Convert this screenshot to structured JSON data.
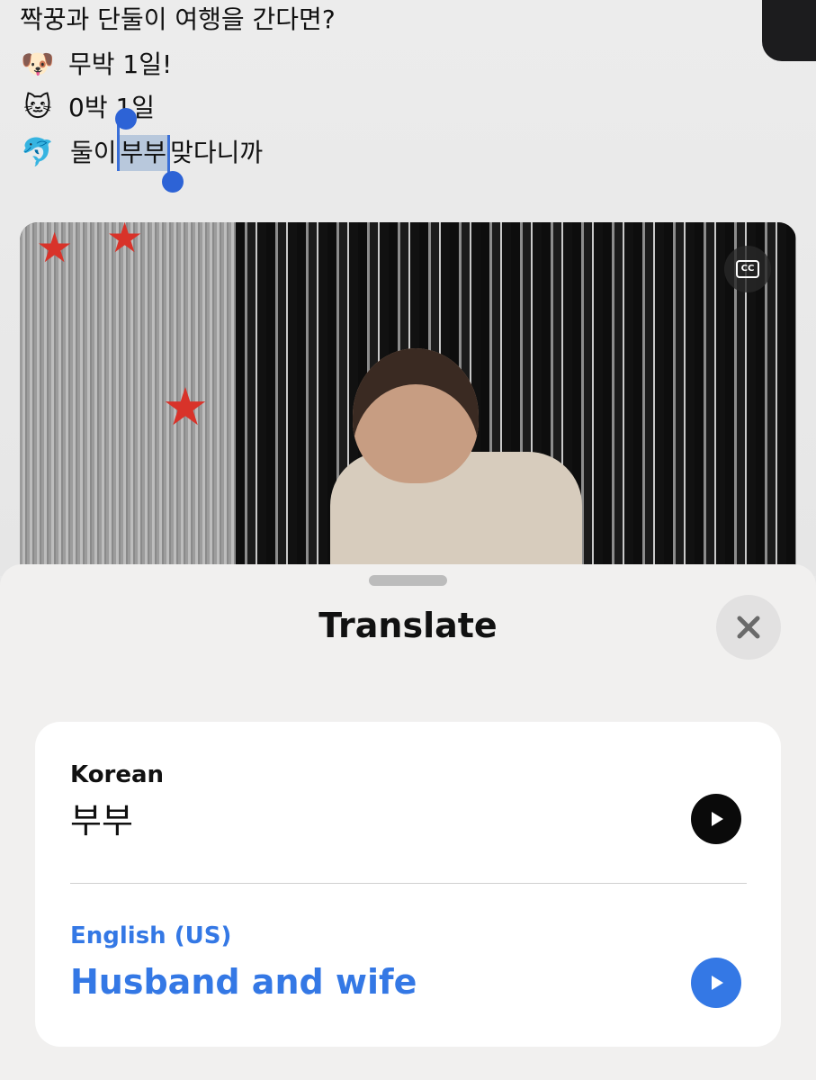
{
  "post": {
    "lines": [
      {
        "text": "짝꿍과 단둘이 여행을 간다면?"
      },
      {
        "emoji": "🐶",
        "text": "무박 1일!"
      },
      {
        "emoji": "🐱",
        "text": "0박 1일"
      },
      {
        "emoji": "🐬",
        "text_before": "둘이 ",
        "selected": "부부",
        "text_after": " 맞다니까"
      }
    ]
  },
  "video": {
    "cc_icon": "closed-captions-icon",
    "cc_label": "CC"
  },
  "translate_sheet": {
    "title": "Translate",
    "close_icon": "close-icon",
    "source": {
      "language": "Korean",
      "text": "부부",
      "play_icon": "play-icon"
    },
    "target": {
      "language": "English (US)",
      "text": "Husband and wife",
      "play_icon": "play-icon"
    },
    "colors": {
      "accent": "#3478e5",
      "sheet_bg": "#f1f0ef",
      "card_bg": "#ffffff"
    }
  }
}
